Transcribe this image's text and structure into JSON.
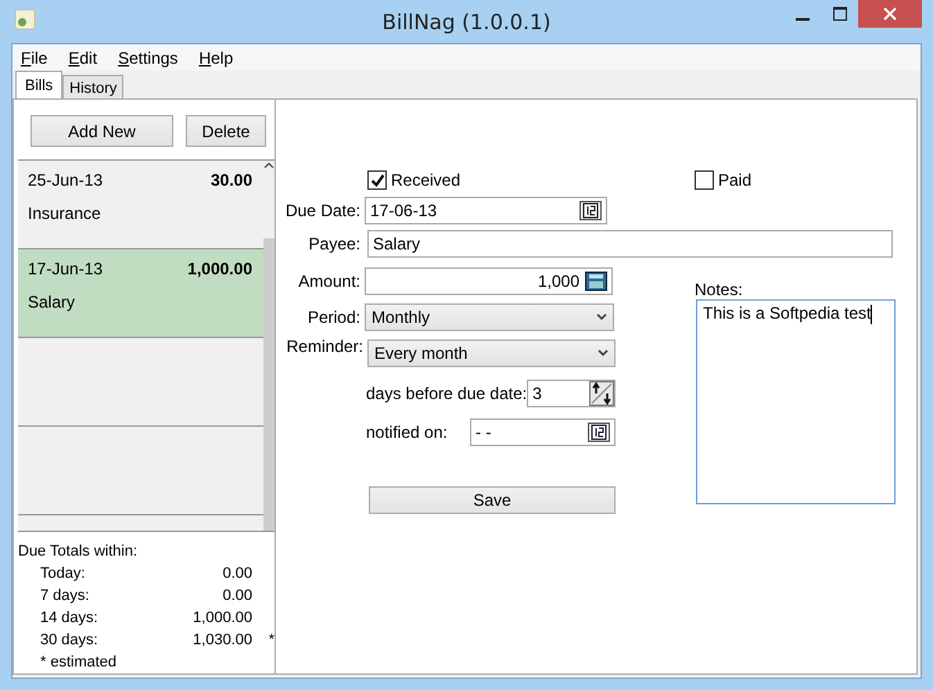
{
  "window": {
    "title": "BillNag (1.0.0.1)"
  },
  "menu": [
    {
      "label": "File"
    },
    {
      "label": "Edit"
    },
    {
      "label": "Settings"
    },
    {
      "label": "Help"
    }
  ],
  "tabs": [
    {
      "label": "Bills",
      "selected": true
    },
    {
      "label": "History",
      "selected": false
    }
  ],
  "list_buttons": [
    "Add New",
    "Delete"
  ],
  "bills": [
    {
      "date": "25-Jun-13",
      "amount": "30.00",
      "payee": "Insurance",
      "selected": false
    },
    {
      "date": "17-Jun-13",
      "amount": "1,000.00",
      "payee": "Salary",
      "selected": true
    }
  ],
  "totals": {
    "title": "Due Totals within:",
    "rows": [
      {
        "label": "Today:",
        "value": "0.00",
        "mark": ""
      },
      {
        "label": "7 days:",
        "value": "0.00",
        "mark": ""
      },
      {
        "label": "14 days:",
        "value": "1,000.00",
        "mark": ""
      },
      {
        "label": "30 days:",
        "value": "1,030.00",
        "mark": "*"
      }
    ],
    "footnote": "* estimated"
  },
  "form": {
    "received": {
      "label": "Received",
      "checked": true
    },
    "paid": {
      "label": "Paid",
      "checked": false
    },
    "due_date": {
      "label": "Due Date:",
      "value": "17-06-13"
    },
    "payee": {
      "label": "Payee:",
      "value": "Salary"
    },
    "amount": {
      "label": "Amount:",
      "value": "1,000"
    },
    "period": {
      "label": "Period:",
      "value": "Monthly"
    },
    "reminder": {
      "label": "Reminder:",
      "value": "Every month"
    },
    "days_before": {
      "label": "days before due date:",
      "value": "3"
    },
    "notified_on": {
      "label": "notified on:",
      "value": "- -"
    },
    "save": "Save",
    "notes": {
      "label": "Notes:",
      "value": "This is a Softpedia test"
    }
  }
}
